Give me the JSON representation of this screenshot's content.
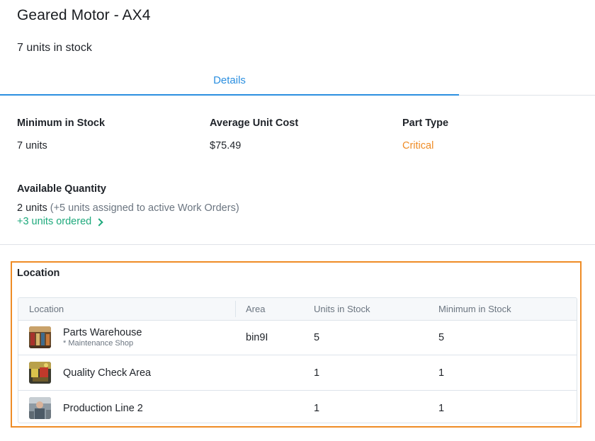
{
  "header": {
    "title": "Geared Motor - AX4",
    "stock_summary": "7 units in stock"
  },
  "tabs": [
    {
      "label": "Details",
      "active": true
    }
  ],
  "details": {
    "minimum_label": "Minimum in Stock",
    "minimum_value": "7 units",
    "cost_label": "Average Unit Cost",
    "cost_value": "$75.49",
    "type_label": "Part Type",
    "type_value": "Critical",
    "available_label": "Available Quantity",
    "available_value": "2 units",
    "available_note": "(+5 units assigned to active Work Orders)",
    "ordered_link": "+3 units ordered"
  },
  "location": {
    "section_title": "Location",
    "columns": [
      "Location",
      "Area",
      "Units in Stock",
      "Minimum in Stock"
    ],
    "rows": [
      {
        "name": "Parts Warehouse",
        "sub": "* Maintenance Shop",
        "area": "bin9I",
        "units": "5",
        "minimum": "5",
        "thumb_icon": "warehouse-photo"
      },
      {
        "name": "Quality Check Area",
        "sub": "",
        "area": "",
        "units": "1",
        "minimum": "1",
        "thumb_icon": "qc-area-photo"
      },
      {
        "name": "Production Line 2",
        "sub": "",
        "area": "",
        "units": "1",
        "minimum": "1",
        "thumb_icon": "production-line-photo"
      }
    ]
  },
  "colors": {
    "accent_blue": "#2b8fe0",
    "critical_orange": "#ef8c25",
    "link_green": "#1ea97c",
    "highlight_border": "#ef8c25"
  }
}
